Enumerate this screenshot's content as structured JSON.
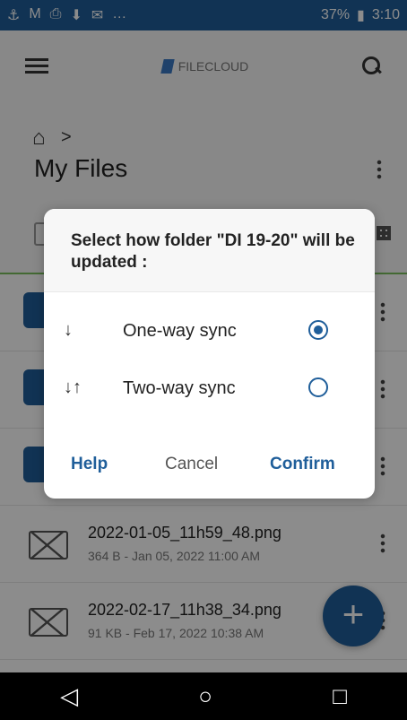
{
  "status_bar": {
    "left_icons": [
      "⚓",
      "M",
      "⎙",
      "⬇",
      "✉",
      "…"
    ],
    "battery": "37%",
    "time": "3:10"
  },
  "app_bar": {
    "logo_text": "FILECLOUD"
  },
  "header": {
    "breadcrumb_separator": ">",
    "title": "My Files"
  },
  "dialog": {
    "prompt": "Select how folder \"DI 19-20\" will be updated :",
    "options": [
      {
        "icon": "↓",
        "label": "One-way sync",
        "selected": true
      },
      {
        "icon": "↓↑",
        "label": "Two-way sync",
        "selected": false
      }
    ],
    "help": "Help",
    "cancel": "Cancel",
    "confirm": "Confirm"
  },
  "files": [
    {
      "name": "2022-01-05_11h59_48.png",
      "meta": "364 B - Jan 05, 2022 11:00 AM"
    },
    {
      "name": "2022-02-17_11h38_34.png",
      "meta": "91 KB - Feb 17, 2022 10:38 AM"
    }
  ],
  "fab_label": "+",
  "nav": {
    "back": "◁",
    "home": "○",
    "recent": "□"
  }
}
